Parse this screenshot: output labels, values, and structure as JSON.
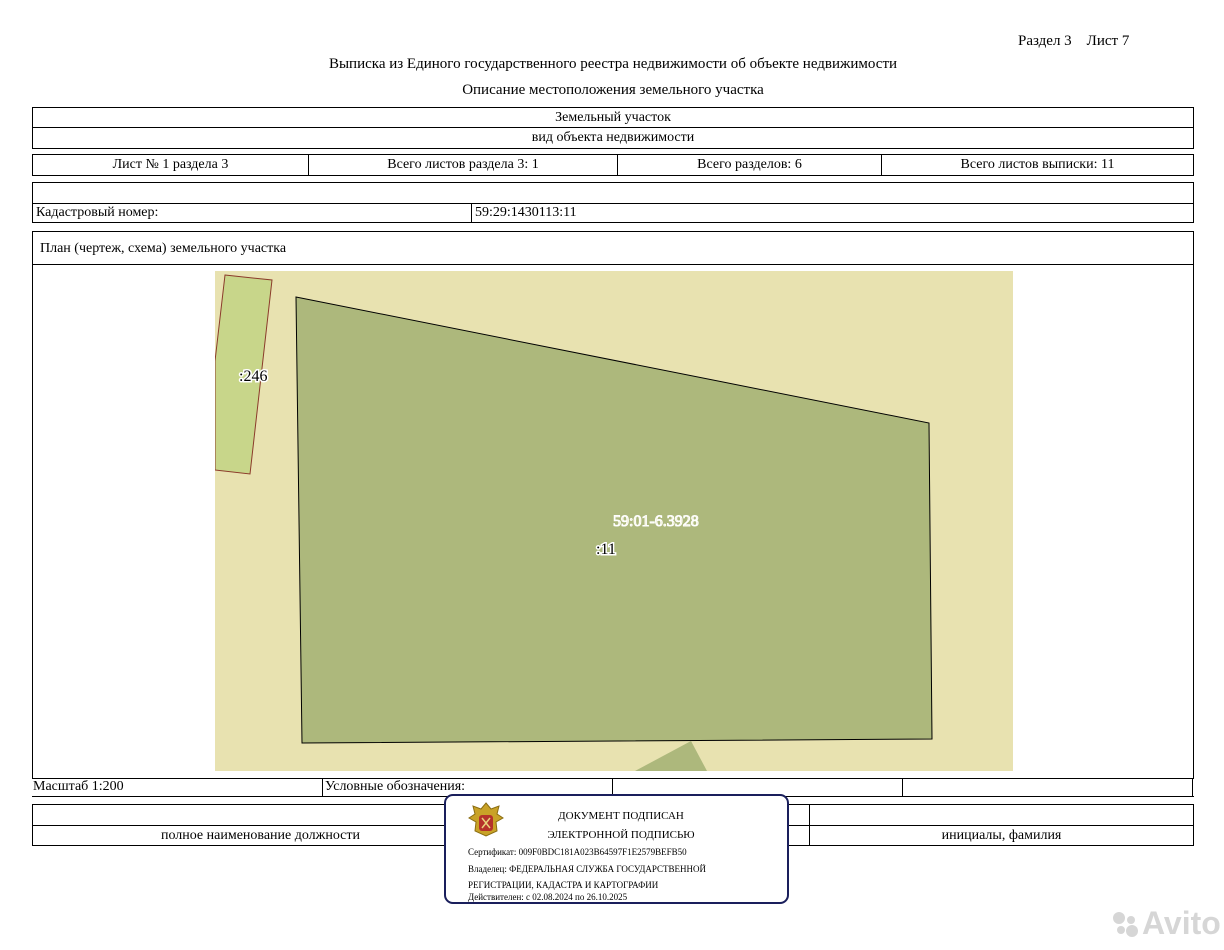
{
  "header": {
    "section_sheet": "Раздел 3    Лист 7",
    "title": "Выписка из Единого государственного реестра недвижимости об объекте недвижимости",
    "subtitle": "Описание местоположения земельного участка"
  },
  "object": {
    "type_value": "Земельный участок",
    "type_caption": "вид объекта недвижимости"
  },
  "sheet_info": {
    "sheet_no": "Лист № 1 раздела 3",
    "total_section_sheets": "Всего листов раздела 3: 1",
    "total_sections": "Всего разделов: 6",
    "total_extract_sheets": "Всего листов выписки: 11"
  },
  "cadastral": {
    "label": "Кадастровый номер:",
    "value": "59:29:1430113:11"
  },
  "plan": {
    "title": "План (чертеж, схема) земельного участка",
    "label_neighbor": ":246",
    "label_quarter": "59:01-6.3928",
    "label_parcel": ":11",
    "colors": {
      "background": "#e8e2b0",
      "parcel_fill": "#adb87c",
      "neighbor_fill": "#c8d68a",
      "neighbor_stroke": "#8b3a2a"
    }
  },
  "legend_row": {
    "scale": "Масштаб 1:200",
    "legend_label": "Условные обозначения:"
  },
  "signature_row": {
    "position": "полное наименование должности",
    "initials": "инициалы, фамилия"
  },
  "esign": {
    "line1": "ДОКУМЕНТ ПОДПИСАН",
    "line2": "ЭЛЕКТРОННОЙ ПОДПИСЬЮ",
    "certificate": "Сертификат: 009F0BDC181A023B64597F1E2579BEFB50",
    "owner_line1": "Владелец: ФЕДЕРАЛЬНАЯ СЛУЖБА ГОСУДАРСТВЕННОЙ",
    "owner_line2": "РЕГИСТРАЦИИ, КАДАСТРА И КАРТОГРАФИИ",
    "valid": "Действителен: с 02.08.2024 по 26.10.2025",
    "border_color": "#1a1f5c"
  },
  "watermark": {
    "text": "Avito"
  }
}
